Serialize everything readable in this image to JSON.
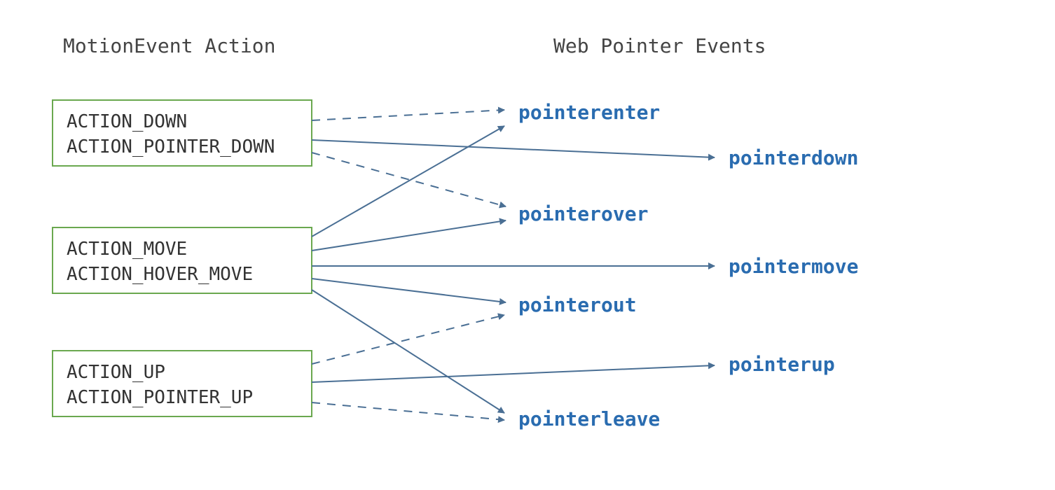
{
  "headings": {
    "left": "MotionEvent Action",
    "right": "Web Pointer Events"
  },
  "leftBoxes": [
    {
      "lines": [
        "ACTION_DOWN",
        "ACTION_POINTER_DOWN"
      ]
    },
    {
      "lines": [
        "ACTION_MOVE",
        "ACTION_HOVER_MOVE"
      ]
    },
    {
      "lines": [
        "ACTION_UP",
        "ACTION_POINTER_UP"
      ]
    }
  ],
  "rightEvents": {
    "pointerenter": "pointerenter",
    "pointerdown": "pointerdown",
    "pointerover": "pointerover",
    "pointermove": "pointermove",
    "pointerout": "pointerout",
    "pointerup": "pointerup",
    "pointerleave": "pointerleave"
  },
  "colors": {
    "arrow": "#4a6f94",
    "webText": "#2a6cb0",
    "boxStroke": "#6aa84f",
    "heading": "#444444"
  }
}
